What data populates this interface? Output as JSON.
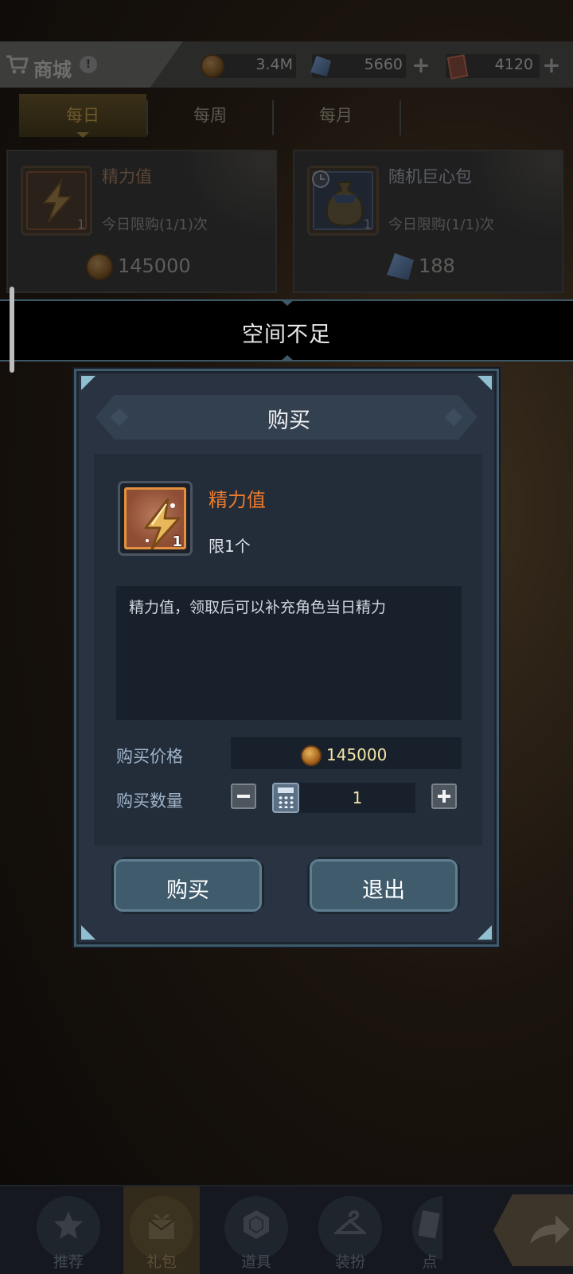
{
  "shop": {
    "title": "商城",
    "info_icon_text": "!",
    "currencies": [
      {
        "icon": "gold-coin-icon",
        "value": "3.4M",
        "has_plus": false
      },
      {
        "icon": "blue-crystal-icon",
        "value": "5660",
        "has_plus": true
      },
      {
        "icon": "red-ticket-icon",
        "value": "4120",
        "has_plus": true
      }
    ],
    "tabs": [
      {
        "label": "每日",
        "active": true
      },
      {
        "label": "每周",
        "active": false
      },
      {
        "label": "每月",
        "active": false
      }
    ],
    "cards": [
      {
        "name": "精力值",
        "limit": "今日限购(1/1)次",
        "price": "145000",
        "qty": "1",
        "currency": "gold-coin-icon"
      },
      {
        "name": "随机巨心包",
        "limit": "今日限购(1/1)次",
        "price": "188",
        "qty": "1",
        "currency": "blue-crystal-icon"
      }
    ]
  },
  "notice": {
    "text": "空间不足"
  },
  "dialog": {
    "title": "购买",
    "item": {
      "name": "精力值",
      "limit": "限1个",
      "qty": "1"
    },
    "description": "精力值，领取后可以补充角色当日精力",
    "price_label": "购买价格",
    "price_value": "145000",
    "quantity_label": "购买数量",
    "quantity_value": "1",
    "buy_button": "购买",
    "exit_button": "退出"
  },
  "bottom_nav": [
    {
      "label": "推荐",
      "icon": "star-icon",
      "active": false
    },
    {
      "label": "礼包",
      "icon": "gift-icon",
      "active": true
    },
    {
      "label": "道具",
      "icon": "hexagon-icon",
      "active": false
    },
    {
      "label": "装扮",
      "icon": "hanger-icon",
      "active": false
    },
    {
      "label": "点",
      "icon": "card-icon",
      "active": false
    }
  ],
  "colors": {
    "item_name": "#ec7a2c",
    "price_text": "#f5e6a8",
    "dialog_bg": "#293342",
    "button_bg": "#3f5b6c"
  }
}
